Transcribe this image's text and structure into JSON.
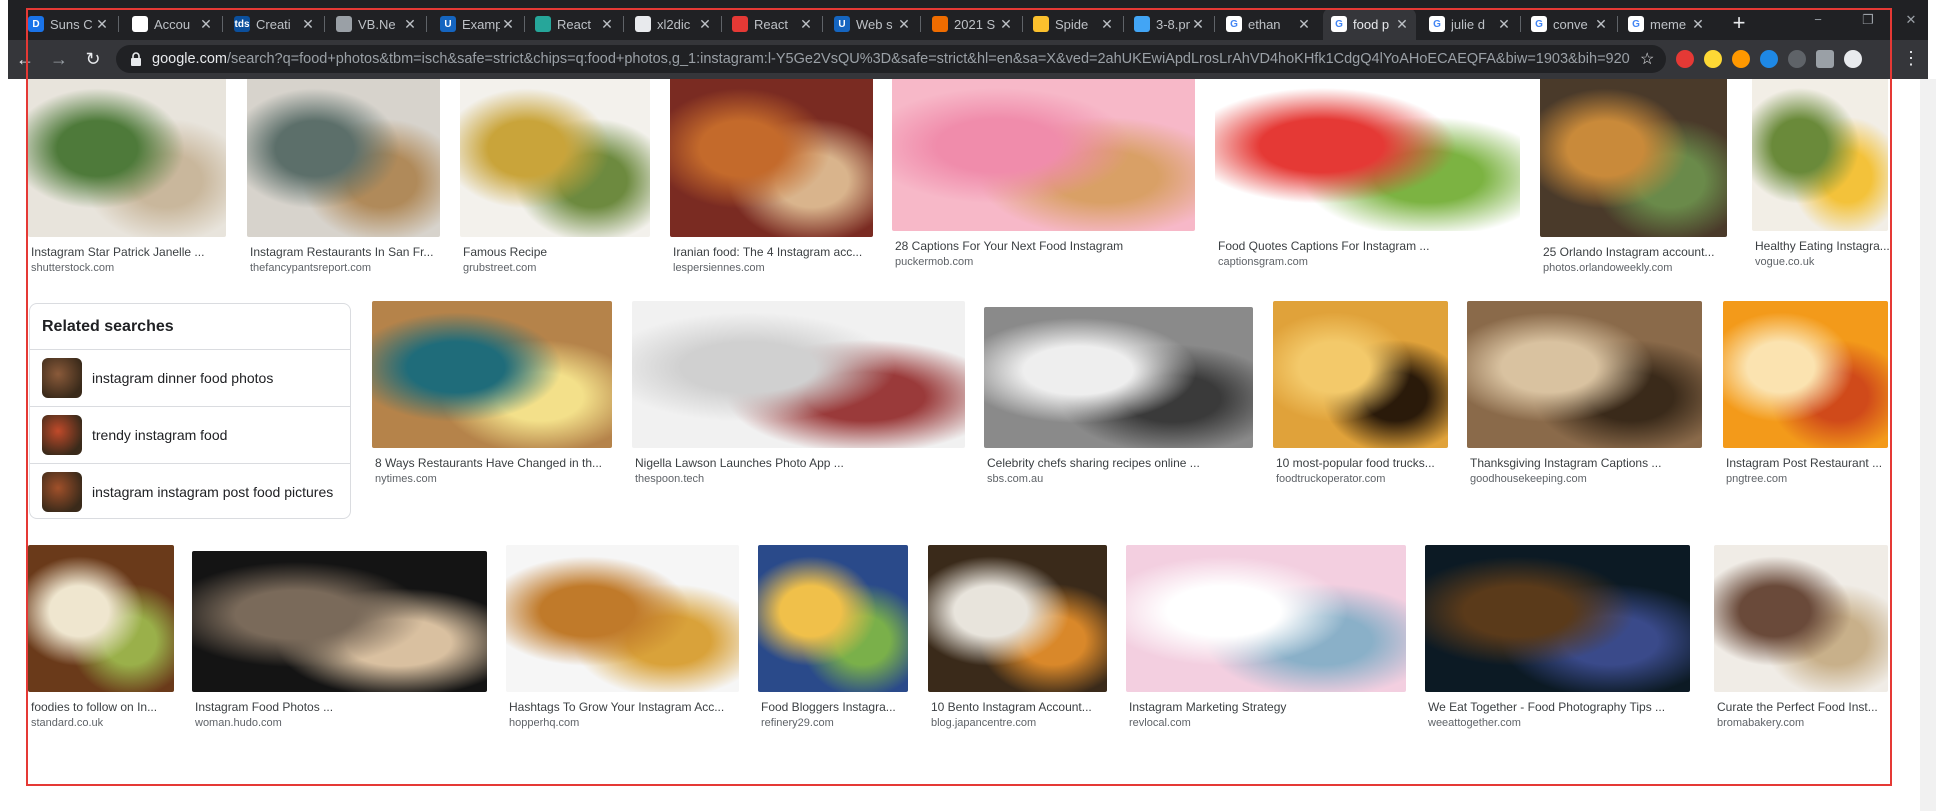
{
  "tabs": [
    {
      "title": "Suns C",
      "fav_letter": "D",
      "fav_color": "#1a73e8",
      "active": false
    },
    {
      "title": "Accou",
      "fav_letter": "",
      "fav_color": "#ffffff",
      "active": false
    },
    {
      "title": "Creati",
      "fav_letter": "tds",
      "fav_color": "#0b4f9c",
      "active": false
    },
    {
      "title": "VB.Ne",
      "fav_letter": "",
      "fav_color": "#9aa0a6",
      "active": false
    },
    {
      "title": "Examp",
      "fav_letter": "U",
      "fav_color": "#1565c0",
      "active": false
    },
    {
      "title": "React",
      "fav_letter": "",
      "fav_color": "#26a69a",
      "active": false
    },
    {
      "title": "xl2dic",
      "fav_letter": "",
      "fav_color": "#e8eaed",
      "active": false
    },
    {
      "title": "React",
      "fav_letter": "",
      "fav_color": "#e53935",
      "active": false
    },
    {
      "title": "Web s",
      "fav_letter": "U",
      "fav_color": "#1565c0",
      "active": false
    },
    {
      "title": "2021 S",
      "fav_letter": "",
      "fav_color": "#ef6c00",
      "active": false
    },
    {
      "title": "Spide",
      "fav_letter": "",
      "fav_color": "#fbc02d",
      "active": false
    },
    {
      "title": "3-8.pn",
      "fav_letter": "",
      "fav_color": "#42a5f5",
      "active": false
    },
    {
      "title": "ethan",
      "fav_letter": "G",
      "fav_color": "#ffffff",
      "active": false
    },
    {
      "title": "food p",
      "fav_letter": "G",
      "fav_color": "#ffffff",
      "active": true
    },
    {
      "title": "julie d",
      "fav_letter": "G",
      "fav_color": "#ffffff",
      "active": false
    },
    {
      "title": "conve",
      "fav_letter": "G",
      "fav_color": "#ffffff",
      "active": false
    },
    {
      "title": "meme",
      "fav_letter": "G",
      "fav_color": "#ffffff",
      "active": false
    }
  ],
  "toolbar": {
    "back_icon": "arrow-left",
    "forward_icon": "arrow-right",
    "reload_icon": "reload",
    "url_domain": "google.com",
    "url_path": "/search?q=food+photos&tbm=isch&safe=strict&chips=q:food+photos,g_1:instagram:l-Y5Ge2VsQU%3D&safe=strict&hl=en&sa=X&ved=2ahUKEwiApdLrosLrAhVD4hoKHfk1CdgQ4lYoAHoECAEQFA&biw=1903&bih=920"
  },
  "results": [
    {
      "title": "Instagram Star Patrick Janelle ...",
      "source": "shutterstock.com",
      "colors": [
        "#e8e4dc",
        "#4e7a3a",
        "#c9b79c"
      ]
    },
    {
      "title": "Instagram Restaurants In San Fr...",
      "source": "thefancypantsreport.com",
      "colors": [
        "#d7d3cc",
        "#5c6f6a",
        "#b08a5a"
      ]
    },
    {
      "title": "Famous Recipe",
      "source": "grubstreet.com",
      "colors": [
        "#f3f1ec",
        "#c9a43a",
        "#6d8a3f"
      ]
    },
    {
      "title": "Iranian food: The 4 Instagram acc...",
      "source": "lespersiennes.com",
      "colors": [
        "#7a2b22",
        "#c46a2b",
        "#d9b48c"
      ]
    },
    {
      "title": "28 Captions For Your Next Food Instagram",
      "source": "puckermob.com",
      "colors": [
        "#f7b8c8",
        "#f08cab",
        "#d9a066"
      ]
    },
    {
      "title": "Food Quotes Captions For Instagram ...",
      "source": "captionsgram.com",
      "colors": [
        "#ffffff",
        "#e53935",
        "#7cb342"
      ]
    },
    {
      "title": "25 Orlando Instagram account...",
      "source": "photos.orlandoweekly.com",
      "colors": [
        "#4a3a2a",
        "#c98a3a",
        "#6a8a4a"
      ]
    },
    {
      "title": "Healthy Eating Instagra...",
      "source": "vogue.co.uk",
      "colors": [
        "#f2eee6",
        "#6a8a3a",
        "#f3c23a"
      ]
    },
    {
      "title": "8 Ways Restaurants Have Changed in th...",
      "source": "nytimes.com",
      "colors": [
        "#b5834a",
        "#1f6c7a",
        "#f3e08a"
      ]
    },
    {
      "title": "Nigella Lawson Launches Photo App ...",
      "source": "thespoon.tech",
      "colors": [
        "#f1f1f1",
        "#d0d0d0",
        "#9a3a3a"
      ]
    },
    {
      "title": "Celebrity chefs sharing recipes online ...",
      "source": "sbs.com.au",
      "colors": [
        "#8a8a8a",
        "#eeeeee",
        "#3a3a3a"
      ]
    },
    {
      "title": "10 most-popular food trucks...",
      "source": "foodtruckoperator.com",
      "colors": [
        "#e0a23a",
        "#f3c96a",
        "#2a1a0a"
      ]
    },
    {
      "title": "Thanksgiving Instagram Captions ...",
      "source": "goodhousekeeping.com",
      "colors": [
        "#8a6a4a",
        "#d9c2a0",
        "#3a2a1a"
      ]
    },
    {
      "title": "Instagram Post Restaurant ...",
      "source": "pngtree.com",
      "colors": [
        "#f39a1a",
        "#fbe3b0",
        "#d04a1a"
      ]
    },
    {
      "title": "foodies to follow on In...",
      "source": "standard.co.uk",
      "colors": [
        "#6a3a1a",
        "#efe6cf",
        "#9ab04a"
      ]
    },
    {
      "title": "Instagram Food Photos ...",
      "source": "woman.hudo.com",
      "colors": [
        "#141414",
        "#7a6a5a",
        "#d9c0a0"
      ]
    },
    {
      "title": "Hashtags To Grow Your Instagram Acc...",
      "source": "hopperhq.com",
      "colors": [
        "#f6f6f6",
        "#c07a2a",
        "#d9a23a"
      ]
    },
    {
      "title": "Food Bloggers Instagra...",
      "source": "refinery29.com",
      "colors": [
        "#2a4a8a",
        "#f0c04a",
        "#7ab04a"
      ]
    },
    {
      "title": "10 Bento Instagram Account...",
      "source": "blog.japancentre.com",
      "colors": [
        "#3a2a1a",
        "#e8e4dc",
        "#d9882a"
      ]
    },
    {
      "title": "Instagram Marketing Strategy",
      "source": "revlocal.com",
      "colors": [
        "#f3cfe0",
        "#ffffff",
        "#8ab0c8"
      ]
    },
    {
      "title": "We Eat Together - Food Photography Tips ...",
      "source": "weeattogether.com",
      "colors": [
        "#0c1a24",
        "#5a3a1a",
        "#3a4a8a"
      ]
    },
    {
      "title": "Curate the Perfect Food Inst...",
      "source": "bromabakery.com",
      "colors": [
        "#f0ece6",
        "#6a4a3a",
        "#c8b08a"
      ]
    }
  ],
  "related": {
    "heading": "Related searches",
    "items": [
      {
        "label": "instagram dinner food photos",
        "thumb_color": "#8a5a3a"
      },
      {
        "label": "trendy instagram food",
        "thumb_color": "#c04a2a"
      },
      {
        "label": "instagram instagram post food pictures",
        "thumb_color": "#a0502a"
      }
    ]
  }
}
